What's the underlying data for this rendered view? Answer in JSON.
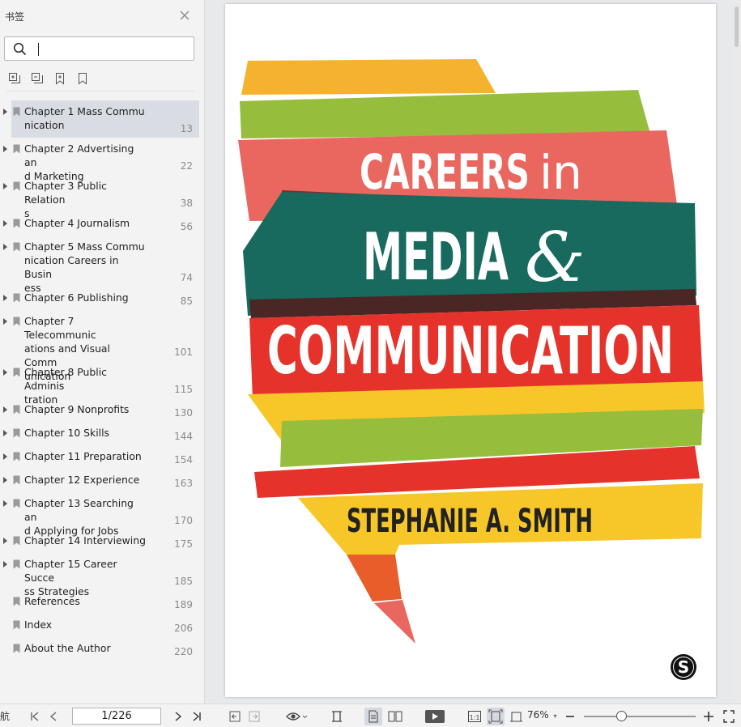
{
  "sidebar": {
    "title": "书签",
    "search": {
      "value": "",
      "placeholder": ""
    },
    "items": [
      {
        "label": "Chapter 1 Mass Commu\nnication",
        "page": "13",
        "expandable": true,
        "selected": true
      },
      {
        "label": "Chapter 2 Advertising an\nd Marketing",
        "page": "22",
        "expandable": true
      },
      {
        "label": "Chapter 3 Public Relation\ns",
        "page": "38",
        "expandable": true
      },
      {
        "label": "Chapter 4 Journalism",
        "page": "56",
        "expandable": true
      },
      {
        "label": "Chapter 5 Mass Commu\nnication Careers in Busin\ness",
        "page": "74",
        "expandable": true
      },
      {
        "label": "Chapter 6 Publishing",
        "page": "85",
        "expandable": true
      },
      {
        "label": "Chapter 7 Telecommunic\nations and Visual Comm\nunication",
        "page": "101",
        "expandable": true
      },
      {
        "label": "Chapter 8 Public Adminis\ntration",
        "page": "115",
        "expandable": true
      },
      {
        "label": "Chapter 9 Nonprofits",
        "page": "130",
        "expandable": true
      },
      {
        "label": "Chapter 10 Skills",
        "page": "144",
        "expandable": true
      },
      {
        "label": "Chapter 11 Preparation",
        "page": "154",
        "expandable": true
      },
      {
        "label": "Chapter 12 Experience",
        "page": "163",
        "expandable": true
      },
      {
        "label": "Chapter 13 Searching an\nd Applying for Jobs",
        "page": "170",
        "expandable": true
      },
      {
        "label": "Chapter 14 Interviewing",
        "page": "175",
        "expandable": true
      },
      {
        "label": "Chapter 15 Career Succe\nss Strategies",
        "page": "185",
        "expandable": true
      },
      {
        "label": "References",
        "page": "189",
        "expandable": false
      },
      {
        "label": "Index",
        "page": "206",
        "expandable": false
      },
      {
        "label": "About the Author",
        "page": "220",
        "expandable": false
      }
    ]
  },
  "cover": {
    "line1": "CAREERS",
    "line1_small": "in",
    "line2": "MEDIA",
    "amp": "&",
    "line3": "COMMUNICATION",
    "author": "STEPHANIE A. SMITH",
    "publisher_mark": "S"
  },
  "statusbar": {
    "left_stub": "航",
    "page_indicator": "1/226",
    "zoom": "76%",
    "zoom_level": 0.33
  },
  "colors": {
    "orange": "#f4b22e",
    "green": "#97bd3d",
    "salmon": "#ea6760",
    "teal": "#176a5d",
    "red": "#e5332b",
    "yellow": "#f7c72a",
    "dark_red": "#6b2a24"
  },
  "icons": {
    "close": "close-icon",
    "search": "search-icon",
    "expand_all": "expand-all-icon",
    "collapse_all": "collapse-all-icon",
    "add_bookmark": "add-bookmark-icon",
    "bookmark": "bookmark-icon"
  }
}
